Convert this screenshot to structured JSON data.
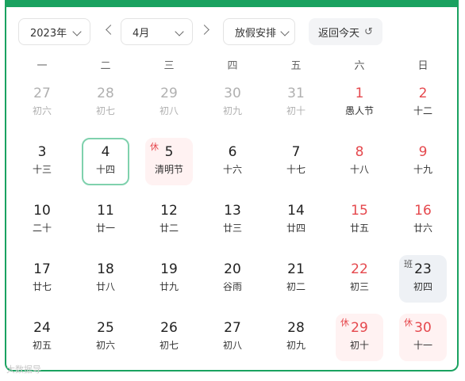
{
  "toolbar": {
    "year": "2023年",
    "month": "4月",
    "holiday_select": "放假安排",
    "back_today": "返回今天"
  },
  "weekdays": [
    "一",
    "二",
    "三",
    "四",
    "五",
    "六",
    "日"
  ],
  "weeks": [
    [
      {
        "d": "27",
        "s": "初六",
        "other": true
      },
      {
        "d": "28",
        "s": "初七",
        "other": true
      },
      {
        "d": "29",
        "s": "初八",
        "other": true
      },
      {
        "d": "30",
        "s": "初九",
        "other": true
      },
      {
        "d": "31",
        "s": "初十",
        "other": true
      },
      {
        "d": "1",
        "s": "愚人节",
        "red": true
      },
      {
        "d": "2",
        "s": "十二",
        "red": true
      }
    ],
    [
      {
        "d": "3",
        "s": "十三"
      },
      {
        "d": "4",
        "s": "十四",
        "today": true
      },
      {
        "d": "5",
        "s": "清明节",
        "holiday": true,
        "tag": "休"
      },
      {
        "d": "6",
        "s": "十六"
      },
      {
        "d": "7",
        "s": "十七"
      },
      {
        "d": "8",
        "s": "十八",
        "red": true
      },
      {
        "d": "9",
        "s": "十九",
        "red": true
      }
    ],
    [
      {
        "d": "10",
        "s": "二十"
      },
      {
        "d": "11",
        "s": "廿一"
      },
      {
        "d": "12",
        "s": "廿二"
      },
      {
        "d": "13",
        "s": "廿三"
      },
      {
        "d": "14",
        "s": "廿四"
      },
      {
        "d": "15",
        "s": "廿五",
        "red": true
      },
      {
        "d": "16",
        "s": "廿六",
        "red": true
      }
    ],
    [
      {
        "d": "17",
        "s": "廿七"
      },
      {
        "d": "18",
        "s": "廿八"
      },
      {
        "d": "19",
        "s": "廿九"
      },
      {
        "d": "20",
        "s": "谷雨"
      },
      {
        "d": "21",
        "s": "初二"
      },
      {
        "d": "22",
        "s": "初三",
        "red": true
      },
      {
        "d": "23",
        "s": "初四",
        "work": true,
        "tag": "班"
      }
    ],
    [
      {
        "d": "24",
        "s": "初五"
      },
      {
        "d": "25",
        "s": "初六"
      },
      {
        "d": "26",
        "s": "初七"
      },
      {
        "d": "27",
        "s": "初八"
      },
      {
        "d": "28",
        "s": "初九"
      },
      {
        "d": "29",
        "s": "初十",
        "red": true,
        "holiday": true,
        "tag": "休"
      },
      {
        "d": "30",
        "s": "十一",
        "red": true,
        "holiday": true,
        "tag": "休"
      }
    ]
  ],
  "watermark": "大数据导"
}
